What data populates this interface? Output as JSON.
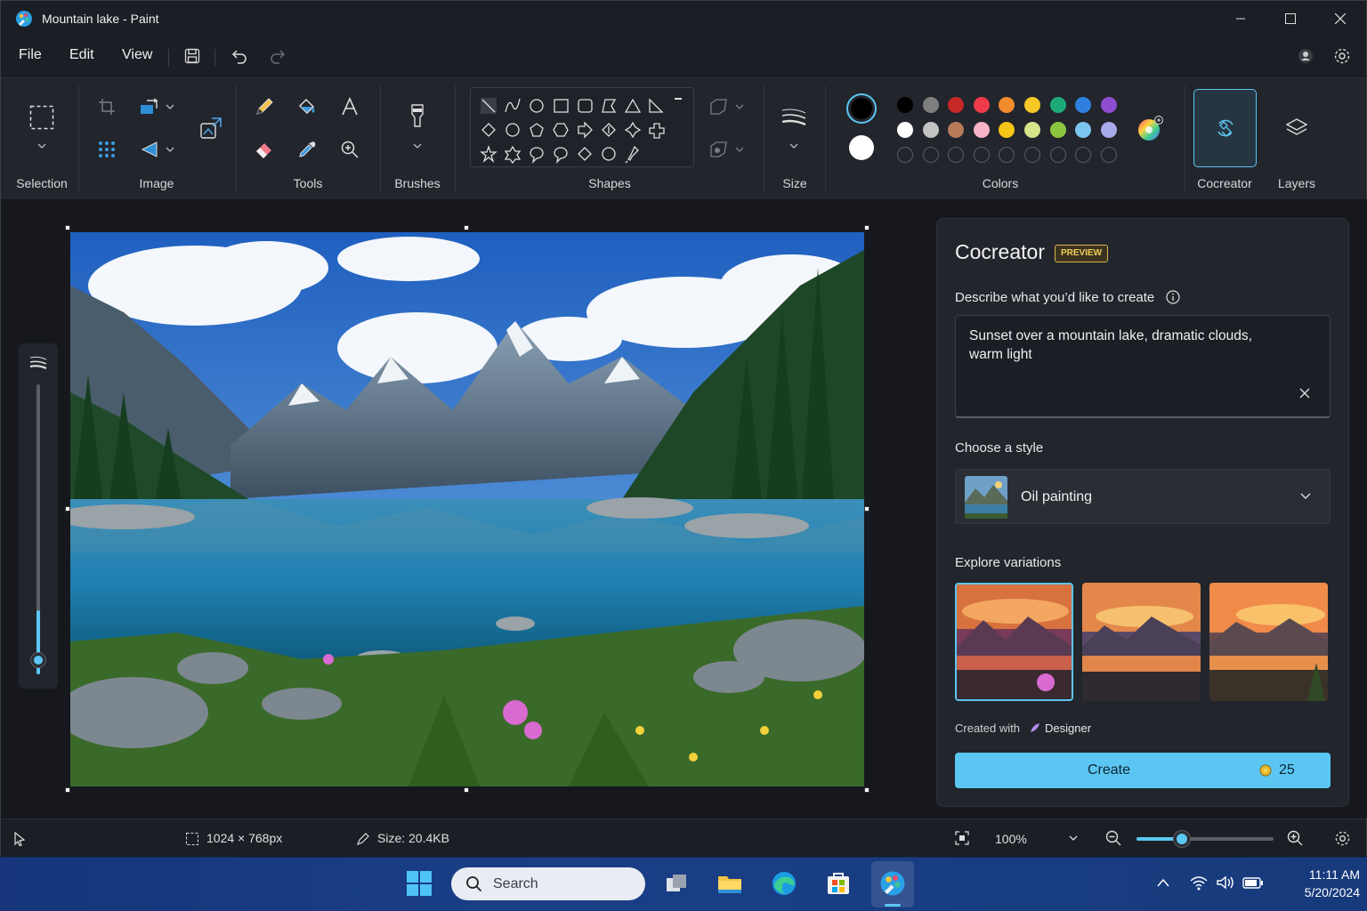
{
  "window": {
    "title": "Mountain lake - Paint"
  },
  "menu": {
    "file": "File",
    "edit": "Edit",
    "view": "View"
  },
  "ribbon": {
    "groups": {
      "selection": "Selection",
      "image": "Image",
      "tools": "Tools",
      "brushes": "Brushes",
      "shapes": "Shapes",
      "size": "Size",
      "colors": "Colors",
      "cocreator": "Cocreator",
      "layers": "Layers"
    },
    "colors": {
      "primary": "#000000",
      "secondary": "#ffffff",
      "row1": [
        "#000000",
        "#7f7f7f",
        "#c62828",
        "#ef3a4a",
        "#f28a2e",
        "#f6c825",
        "#1eaa78",
        "#2f7fe0",
        "#8e4ccf"
      ],
      "row2": [
        "#ffffff",
        "#c3c3c3",
        "#b97a57",
        "#f7b3c8",
        "#f5c518",
        "#d6e48a",
        "#8cc63f",
        "#7cc5ee",
        "#a7a9e8"
      ]
    }
  },
  "cocreator": {
    "title": "Cocreator",
    "badge": "PREVIEW",
    "prompt_label": "Describe what you’d like to create",
    "prompt_value": "Sunset over a mountain lake, dramatic clouds, warm light",
    "style_label": "Choose a style",
    "style_value": "Oil painting",
    "variations_label": "Explore variations",
    "credit_prefix": "Created with",
    "credit_app": "Designer",
    "create_label": "Create",
    "credits": "25"
  },
  "status": {
    "dimensions": "1024 × 768px",
    "size": "Size: 20.4KB",
    "zoom": "100%",
    "zoom_fraction": 0.33
  },
  "taskbar": {
    "search": "Search",
    "time": "11:11 AM",
    "date": "5/20/2024"
  }
}
